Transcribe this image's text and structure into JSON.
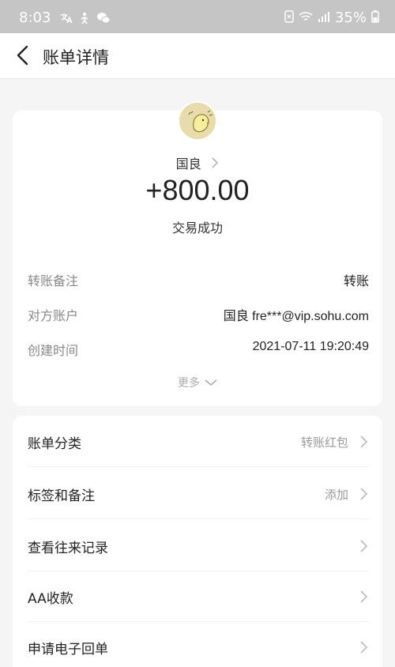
{
  "status_bar": {
    "time": "8:03",
    "battery": "35%"
  },
  "header": {
    "title": "账单详情"
  },
  "transaction": {
    "payee": "国良",
    "amount": "+800.00",
    "status": "交易成功",
    "details": [
      {
        "label": "转账备注",
        "value": "转账"
      },
      {
        "label": "对方账户",
        "value": "国良 fre***@vip.sohu.com"
      },
      {
        "label": "创建时间",
        "value": "2021-07-11 19:20:49"
      }
    ],
    "more_label": "更多"
  },
  "menu": [
    {
      "label": "账单分类",
      "value": "转账红包"
    },
    {
      "label": "标签和备注",
      "value": "添加"
    },
    {
      "label": "查看往来记录",
      "value": ""
    },
    {
      "label": "AA收款",
      "value": ""
    },
    {
      "label": "申请电子回单",
      "value": ""
    }
  ]
}
